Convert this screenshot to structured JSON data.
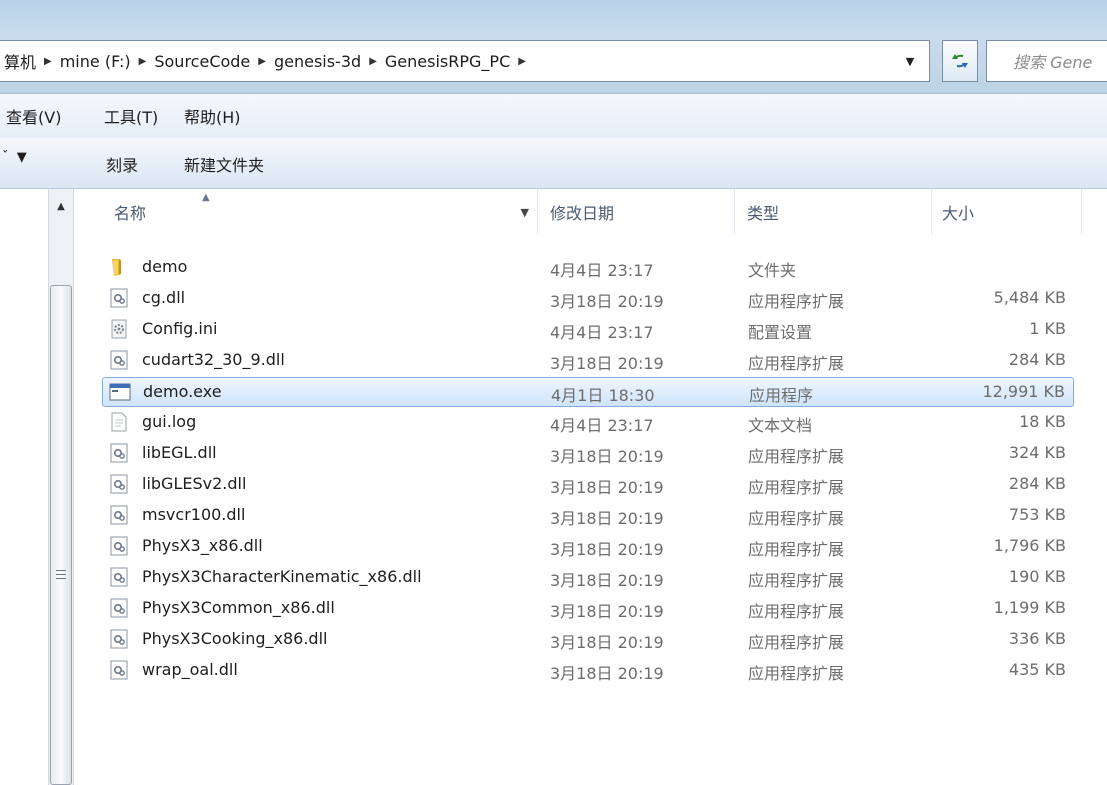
{
  "address": {
    "crumbs": [
      "算机",
      "mine (F:)",
      "SourceCode",
      "genesis-3d",
      "GenesisRPG_PC"
    ],
    "search_placeholder": "搜索 Gene"
  },
  "menu": {
    "view": "查看(V)",
    "tools": "工具(T)",
    "help": "帮助(H)"
  },
  "toolbar": {
    "burn": "刻录",
    "new_folder": "新建文件夹"
  },
  "columns": {
    "name": "名称",
    "date": "修改日期",
    "type": "类型",
    "size": "大小"
  },
  "files": [
    {
      "name": "demo",
      "date": "4月4日 23:17",
      "type": "文件夹",
      "size": "",
      "icon": "folder-icon"
    },
    {
      "name": "cg.dll",
      "date": "3月18日 20:19",
      "type": "应用程序扩展",
      "size": "5,484 KB",
      "icon": "dll-file-icon"
    },
    {
      "name": "Config.ini",
      "date": "4月4日 23:17",
      "type": "配置设置",
      "size": "1 KB",
      "icon": "ini-file-icon"
    },
    {
      "name": "cudart32_30_9.dll",
      "date": "3月18日 20:19",
      "type": "应用程序扩展",
      "size": "284 KB",
      "icon": "dll-file-icon"
    },
    {
      "name": "demo.exe",
      "date": "4月1日 18:30",
      "type": "应用程序",
      "size": "12,991 KB",
      "icon": "exe-file-icon",
      "selected": true
    },
    {
      "name": "gui.log",
      "date": "4月4日 23:17",
      "type": "文本文档",
      "size": "18 KB",
      "icon": "text-file-icon"
    },
    {
      "name": "libEGL.dll",
      "date": "3月18日 20:19",
      "type": "应用程序扩展",
      "size": "324 KB",
      "icon": "dll-file-icon"
    },
    {
      "name": "libGLESv2.dll",
      "date": "3月18日 20:19",
      "type": "应用程序扩展",
      "size": "284 KB",
      "icon": "dll-file-icon"
    },
    {
      "name": "msvcr100.dll",
      "date": "3月18日 20:19",
      "type": "应用程序扩展",
      "size": "753 KB",
      "icon": "dll-file-icon"
    },
    {
      "name": "PhysX3_x86.dll",
      "date": "3月18日 20:19",
      "type": "应用程序扩展",
      "size": "1,796 KB",
      "icon": "dll-file-icon"
    },
    {
      "name": "PhysX3CharacterKinematic_x86.dll",
      "date": "3月18日 20:19",
      "type": "应用程序扩展",
      "size": "190 KB",
      "icon": "dll-file-icon"
    },
    {
      "name": "PhysX3Common_x86.dll",
      "date": "3月18日 20:19",
      "type": "应用程序扩展",
      "size": "1,199 KB",
      "icon": "dll-file-icon"
    },
    {
      "name": "PhysX3Cooking_x86.dll",
      "date": "3月18日 20:19",
      "type": "应用程序扩展",
      "size": "336 KB",
      "icon": "dll-file-icon"
    },
    {
      "name": "wrap_oal.dll",
      "date": "3月18日 20:19",
      "type": "应用程序扩展",
      "size": "435 KB",
      "icon": "dll-file-icon"
    }
  ],
  "colors": {
    "selection_border": "#84acdd",
    "selection_fill": "#cfe4fa",
    "header_text": "#4b5b70"
  }
}
